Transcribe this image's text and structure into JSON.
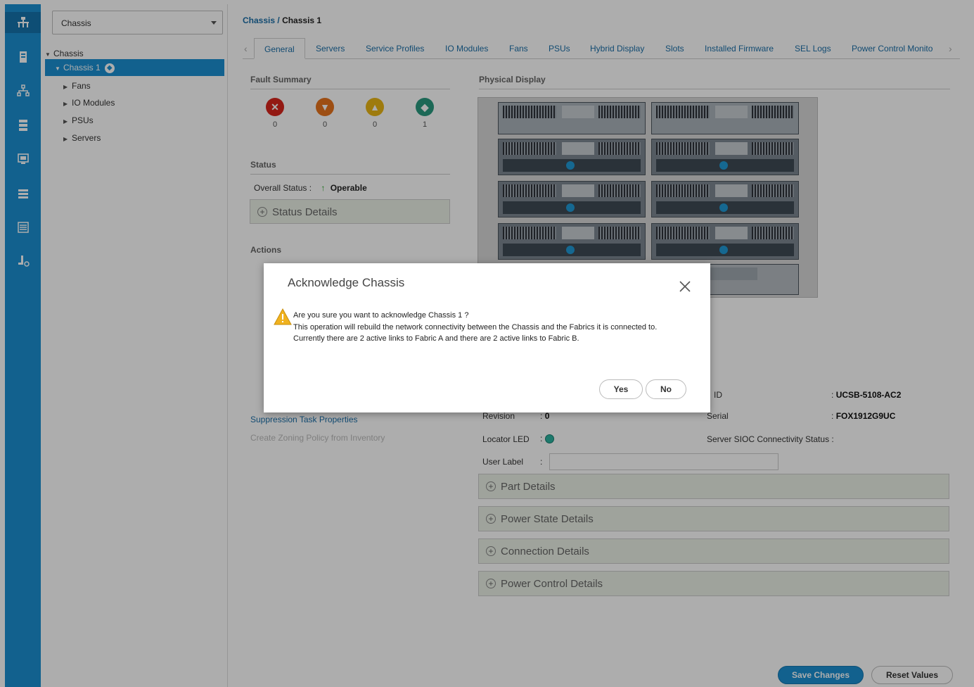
{
  "rail": {
    "icons": [
      "equipment-icon",
      "servers-icon",
      "network-icon",
      "san-icon",
      "vm-icon",
      "storage-icon",
      "chassis-list-icon",
      "admin-icon"
    ]
  },
  "tree": {
    "select_value": "Chassis",
    "items": [
      {
        "label": "Chassis",
        "expanded": true
      },
      {
        "label": "Chassis 1",
        "selected": true
      },
      {
        "label": "Fans"
      },
      {
        "label": "IO Modules"
      },
      {
        "label": "PSUs"
      },
      {
        "label": "Servers"
      }
    ]
  },
  "breadcrumb": {
    "root": "Chassis",
    "sep": "/",
    "current": "Chassis 1"
  },
  "tabs": [
    "General",
    "Servers",
    "Service Profiles",
    "IO Modules",
    "Fans",
    "PSUs",
    "Hybrid Display",
    "Slots",
    "Installed Firmware",
    "SEL Logs",
    "Power Control Monito"
  ],
  "fault_summary": {
    "title": "Fault Summary",
    "critical": "0",
    "major": "0",
    "minor": "0",
    "warning": "1",
    "colors": {
      "critical": "#d9261c",
      "major": "#e8731d",
      "minor": "#e9b616",
      "warning": "#2a9a7f"
    }
  },
  "status": {
    "title": "Status",
    "overall_label": "Overall Status :",
    "overall_value": "Operable",
    "details_label": "Status Details"
  },
  "actions": {
    "title": "Actions",
    "suppression": "Suppression Task Properties",
    "zoning": "Create Zoning Policy from Inventory"
  },
  "physical": {
    "title": "Physical Display"
  },
  "properties": {
    "pid_label": "ID",
    "pid_value": "UCSB-5108-AC2",
    "revision_label": "Revision",
    "revision_value": "0",
    "serial_label": "Serial",
    "serial_value": "FOX1912G9UC",
    "locator_label": "Locator LED",
    "sioc_label": "Server SIOC Connectivity Status :",
    "user_label": "User Label",
    "colon": ":"
  },
  "sections": [
    "Part Details",
    "Power State Details",
    "Connection Details",
    "Power Control Details"
  ],
  "footer": {
    "save": "Save Changes",
    "reset": "Reset Values"
  },
  "dialog": {
    "title": "Acknowledge Chassis",
    "line1": "Are you sure you want to acknowledge Chassis 1 ?",
    "line2": "This operation will rebuild the network connectivity between the Chassis and the Fabrics it is connected to.",
    "line3": "Currently there are 2 active links to Fabric A and there are 2 active links to Fabric B.",
    "yes": "Yes",
    "no": "No"
  }
}
